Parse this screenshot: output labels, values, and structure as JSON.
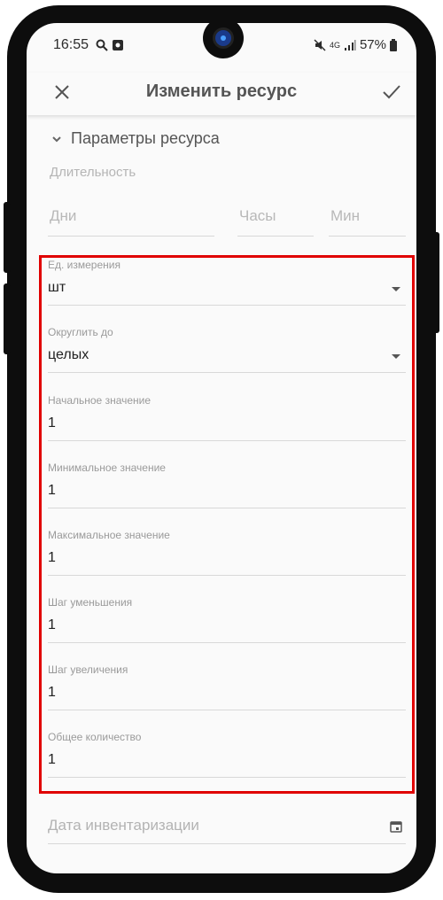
{
  "status_bar": {
    "time": "16:55",
    "network": "4G",
    "battery": "57%"
  },
  "app_bar": {
    "title": "Изменить ресурс"
  },
  "section": {
    "title": "Параметры ресурса"
  },
  "duration": {
    "label": "Длительность",
    "days_placeholder": "Дни",
    "hours_placeholder": "Часы",
    "minutes_placeholder": "Мин"
  },
  "fields": [
    {
      "label": "Ед. измерения",
      "value": "шт",
      "dropdown": true
    },
    {
      "label": "Округлить до",
      "value": "целых",
      "dropdown": true
    },
    {
      "label": "Начальное значение",
      "value": "1"
    },
    {
      "label": "Минимальное значение",
      "value": "1"
    },
    {
      "label": "Максимальное значение",
      "value": "1"
    },
    {
      "label": "Шаг уменьшения",
      "value": "1"
    },
    {
      "label": "Шаг увеличения",
      "value": "1"
    },
    {
      "label": "Общее количество",
      "value": "1"
    }
  ],
  "inventory_date": {
    "placeholder": "Дата инвентаризации"
  },
  "colors": {
    "highlight": "#e00000",
    "background": "#fafafa"
  }
}
